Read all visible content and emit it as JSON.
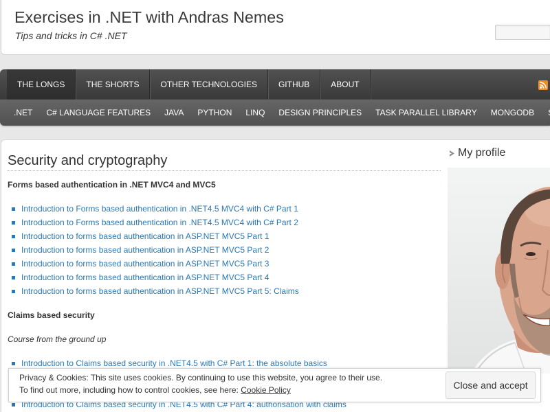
{
  "site": {
    "title": "Exercises in .NET with Andras Nemes",
    "tagline": "Tips and tricks in C# .NET"
  },
  "nav": {
    "primary": [
      {
        "label": "THE LONGS",
        "active": true
      },
      {
        "label": "THE SHORTS",
        "active": false
      },
      {
        "label": "OTHER TECHNOLOGIES",
        "active": false
      },
      {
        "label": "GITHUB",
        "active": false
      },
      {
        "label": "ABOUT",
        "active": false
      }
    ],
    "feed_icon": "rss-icon",
    "secondary": [
      ".NET",
      "C# LANGUAGE FEATURES",
      "JAVA",
      "PYTHON",
      "LINQ",
      "DESIGN PRINCIPLES",
      "TASK PARALLEL LIBRARY",
      "MONGODB",
      "S"
    ]
  },
  "main": {
    "title": "Security and cryptography",
    "forms_section": {
      "heading": "Forms based authentication in .NET MVC4 and MVC5",
      "links": [
        "Introduction to Forms based authentication in .NET4.5 MVC4 with C# Part 1",
        "Introduction to Forms based authentication in .NET4.5 MVC4 with C# Part 2",
        "Introduction to forms based authentication in ASP.NET MVC5 Part 1",
        "Introduction to forms based authentication in ASP.NET MVC5 Part 2",
        "Introduction to forms based authentication in ASP.NET MVC5 Part 3",
        "Introduction to forms based authentication in ASP.NET MVC5 Part 4",
        "Introduction to forms based authentication in ASP.NET MVC5 Part 5: Claims"
      ]
    },
    "claims_section": {
      "heading": "Claims based security",
      "subheading": "Course from the ground up",
      "links": [
        "Introduction to Claims based security in .NET4.5 with C# Part 1: the absolute basics",
        null,
        null,
        "Introduction to Claims based security in .NET4.5 with C# Part 4: authorisation with claims"
      ]
    }
  },
  "sidebar": {
    "profile_heading": "My profile",
    "heading_icon": "widget-bullet-icon",
    "photo": "profile-photo"
  },
  "cookie_banner": {
    "text": "Privacy & Cookies: This site uses cookies. By continuing to use this website, you agree to their use.",
    "more_text": "To find out more, including how to control cookies, see here:",
    "policy_link": "Cookie Policy",
    "button_label": "Close and accept"
  },
  "colors": {
    "page_bg": "#e8e8e8",
    "text": "#333333",
    "link": "#2a78b6",
    "nav_primary": "#404040",
    "nav_secondary": "#595959",
    "rss": "#f48a21"
  }
}
